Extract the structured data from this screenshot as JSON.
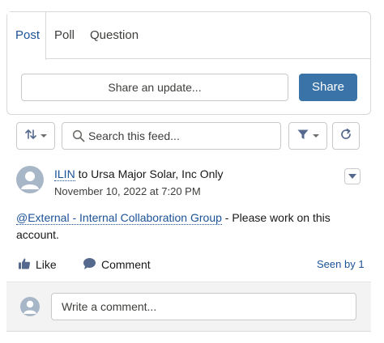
{
  "publisher": {
    "tabs": [
      {
        "label": "Post",
        "active": true
      },
      {
        "label": "Poll",
        "active": false
      },
      {
        "label": "Question",
        "active": false
      }
    ],
    "share_placeholder": "Share an update...",
    "share_button": "Share"
  },
  "toolbar": {
    "sort_icon": "sort-arrows-icon",
    "search_placeholder": "Search this feed...",
    "filter_icon": "filter-icon",
    "refresh_icon": "refresh-icon"
  },
  "post": {
    "author": "ILIN",
    "audience": " to Ursa Major Solar, Inc Only",
    "date": "November 10, 2022 at 7:20 PM",
    "mention": "@External - Internal Collaboration Group",
    "body": " - Please work on this account.",
    "actions": {
      "like": "Like",
      "comment": "Comment",
      "seen_by": "Seen by 1"
    }
  },
  "comment": {
    "placeholder": "Write a comment..."
  },
  "colors": {
    "link": "#1b5297",
    "share_button_bg": "#3a73a8",
    "avatar_bg": "#a8b7c7"
  }
}
